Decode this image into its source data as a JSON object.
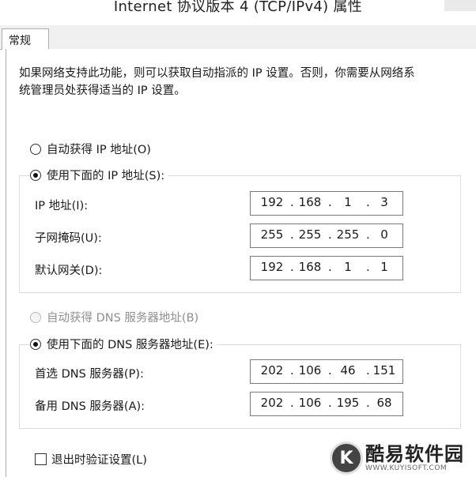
{
  "window": {
    "title": "Internet 协议版本 4 (TCP/IPv4) 属性"
  },
  "tabs": [
    {
      "label": "常规"
    }
  ],
  "description": {
    "line1": "如果网络支持此功能，则可以获取自动指派的 IP 设置。否则，你需要从网络系",
    "line2": "统管理员处获得适当的 IP 设置。"
  },
  "ip_section": {
    "auto_label": "自动获得 IP 地址(O)",
    "manual_label": "使用下面的 IP 地址(S):",
    "selected": "manual",
    "fields": [
      {
        "label": "IP 地址(I):",
        "octets": [
          "192",
          "168",
          "1",
          "3"
        ]
      },
      {
        "label": "子网掩码(U):",
        "octets": [
          "255",
          "255",
          "255",
          "0"
        ]
      },
      {
        "label": "默认网关(D):",
        "octets": [
          "192",
          "168",
          "1",
          "1"
        ]
      }
    ]
  },
  "dns_section": {
    "auto_label": "自动获得 DNS 服务器地址(B)",
    "manual_label": "使用下面的 DNS 服务器地址(E):",
    "selected": "manual",
    "auto_disabled": true,
    "fields": [
      {
        "label": "首选 DNS 服务器(P):",
        "octets": [
          "202",
          "106",
          "46",
          "151"
        ]
      },
      {
        "label": "备用 DNS 服务器(A):",
        "octets": [
          "202",
          "106",
          "195",
          "68"
        ]
      }
    ]
  },
  "validate_on_exit": {
    "label": "退出时验证设置(L)",
    "checked": false
  },
  "watermark": {
    "logo": "K",
    "text": "酷易软件园",
    "sub": "WWW.KUYISOFT.COM"
  }
}
